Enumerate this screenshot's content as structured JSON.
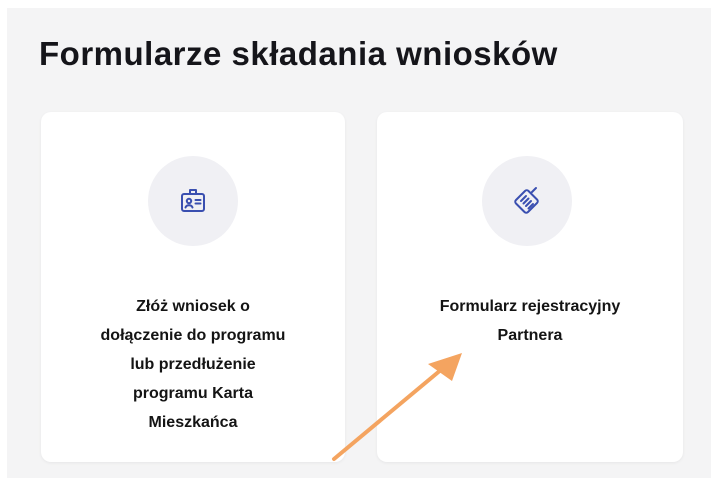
{
  "page": {
    "title": "Formularze składania wniosków"
  },
  "cards": [
    {
      "icon": "id-badge-icon",
      "lines": [
        "Złóż wniosek o",
        "dołączenie do programu",
        "lub przedłużenie",
        "programu Karta",
        "Mieszkańca"
      ]
    },
    {
      "icon": "handshake-icon",
      "lines": [
        "Formularz rejestracyjny",
        "Partnera"
      ]
    }
  ],
  "colors": {
    "background": "#f4f4f5",
    "card": "#ffffff",
    "icon_circle": "#f0f0f4",
    "icon_stroke": "#3a4fb0",
    "annotation_arrow": "#f4a460"
  }
}
